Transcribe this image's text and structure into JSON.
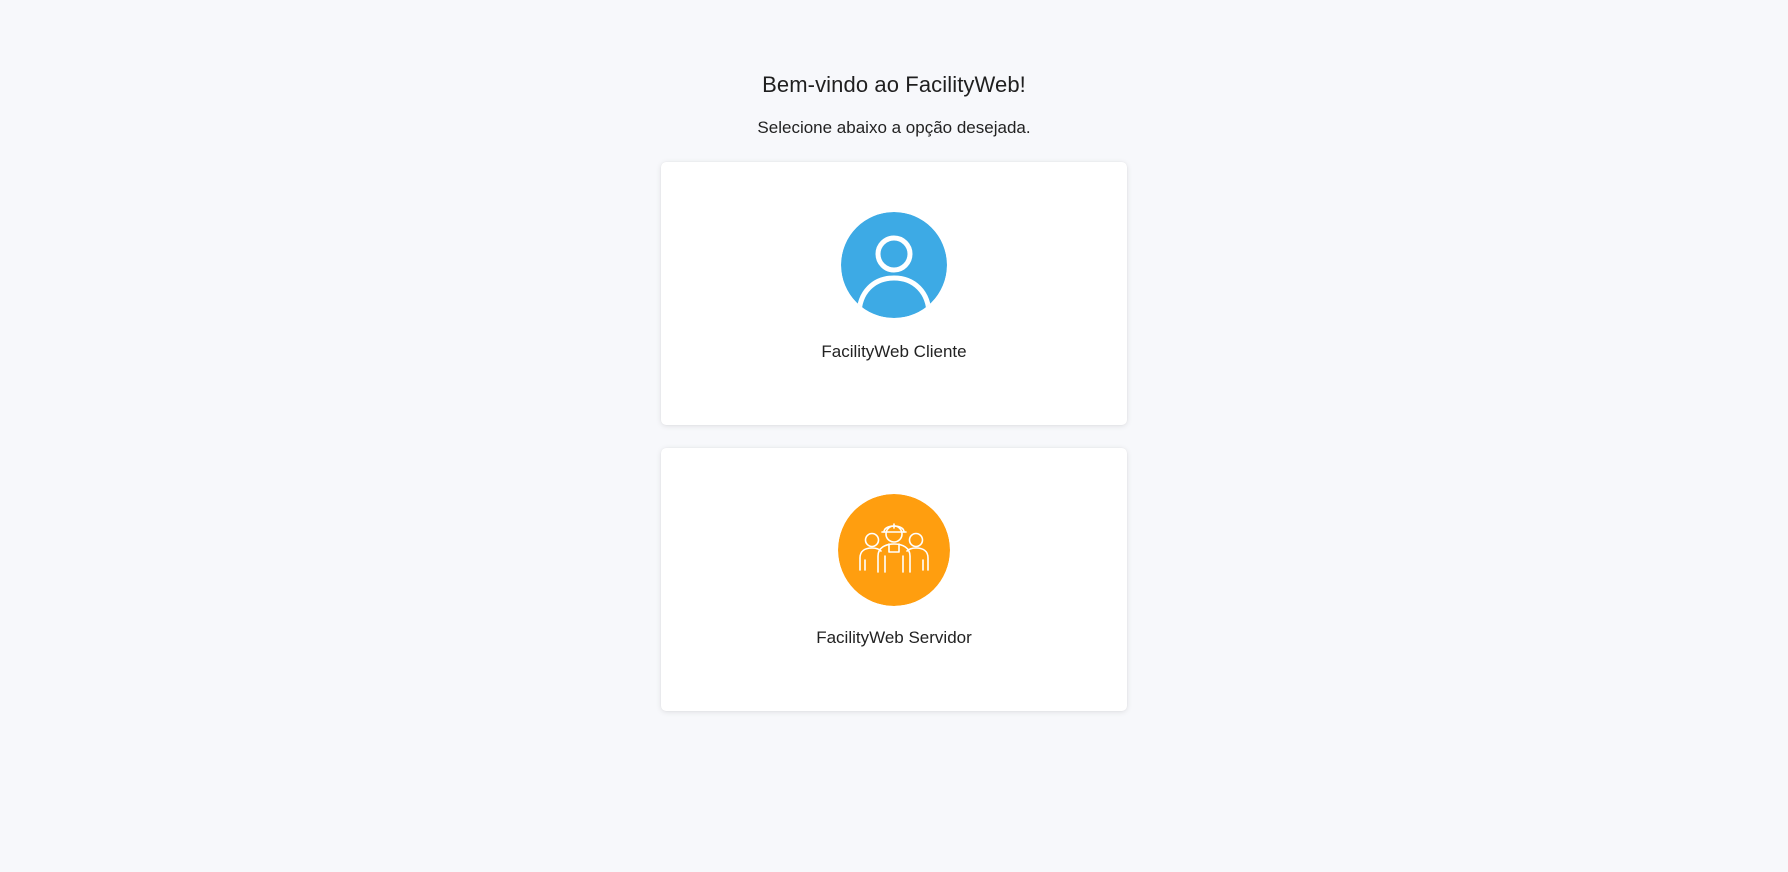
{
  "header": {
    "title": "Bem-vindo ao FacilityWeb!",
    "subtitle": "Selecione abaixo a opção desejada."
  },
  "options": [
    {
      "label": "FacilityWeb Cliente",
      "icon": "user-icon",
      "color": "#3daae5"
    },
    {
      "label": "FacilityWeb Servidor",
      "icon": "workers-group-icon",
      "color": "#ff9e0f"
    }
  ]
}
